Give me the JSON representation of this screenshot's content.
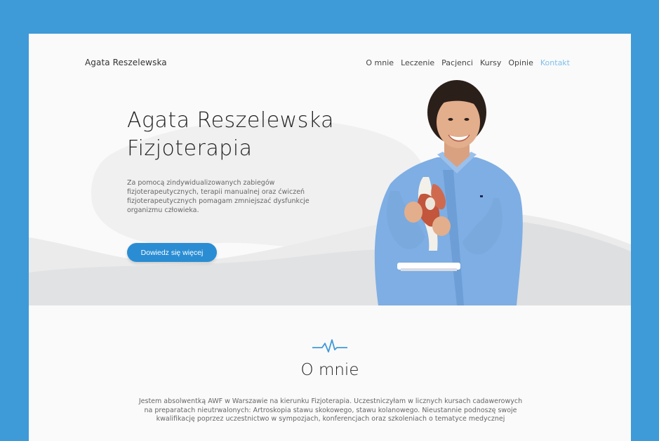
{
  "header": {
    "brand": "Agata Reszelewska",
    "nav": [
      {
        "label": "O mnie"
      },
      {
        "label": "Leczenie"
      },
      {
        "label": "Pacjenci"
      },
      {
        "label": "Kursy"
      },
      {
        "label": "Opinie"
      },
      {
        "label": "Kontakt",
        "active": true
      }
    ]
  },
  "hero": {
    "title_line1": "Agata Reszelewska",
    "title_line2": "Fizjoterapia",
    "description": "Za pomocą zindywidualizowanych zabiegów fizjoterapeutycznych, terapii manualnej oraz ćwiczeń fizjoterapeutycznych pomagam zmniejszać dysfunkcje organizmu człowieka.",
    "cta_label": "Dowiedz się więcej",
    "photo": "therapist-holding-knee-model"
  },
  "about": {
    "icon": "heartbeat-icon",
    "title": "O mnie",
    "text": "Jestem absolwentką AWF w Warszawie na kierunku Fizjoterapia. Uczestniczyłam w licznych kursach cadawerowych na preparatach nieutrwalonych: Artroskopia stawu skokowego, stawu kolanowego. Nieustannie podnoszę swoje kwalifikację poprzez uczestnictwo w sympozjach, konferencjach oraz szkoleniach o tematyce medycznej"
  },
  "colors": {
    "frame": "#3f9ad8",
    "accent": "#2a8dd3",
    "active_link": "#7fc0ea",
    "shirt": "#7eaee3"
  }
}
